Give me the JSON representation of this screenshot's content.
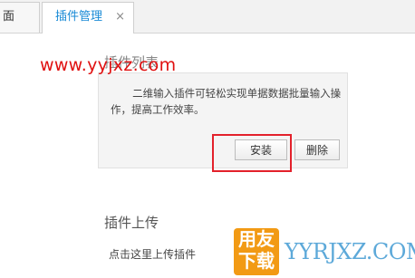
{
  "tabs": [
    {
      "label": "面",
      "active": false
    },
    {
      "label": "插件管理",
      "active": true,
      "close_glyph": "×"
    }
  ],
  "plugin_list": {
    "title": "插件列表",
    "plugin": {
      "description": "二维输入插件可轻松实现单据数据批量输入操作，提高工作效率。",
      "install_label": "安装",
      "delete_label": "删除"
    }
  },
  "plugin_upload": {
    "title": "插件上传",
    "link_label": "点击这里上传插件"
  },
  "watermark": {
    "url": "www.yyjxz.com",
    "logo_line1": "用友",
    "logo_line2": "下载",
    "logo_text": "YYRJXZ.COM"
  },
  "colors": {
    "active_tab_text": "#1a8bd6",
    "highlight": "#e3212b",
    "watermark_red": "#e01010",
    "logo_orange": "#f29a14",
    "logo_blue": "#5da9d9"
  }
}
